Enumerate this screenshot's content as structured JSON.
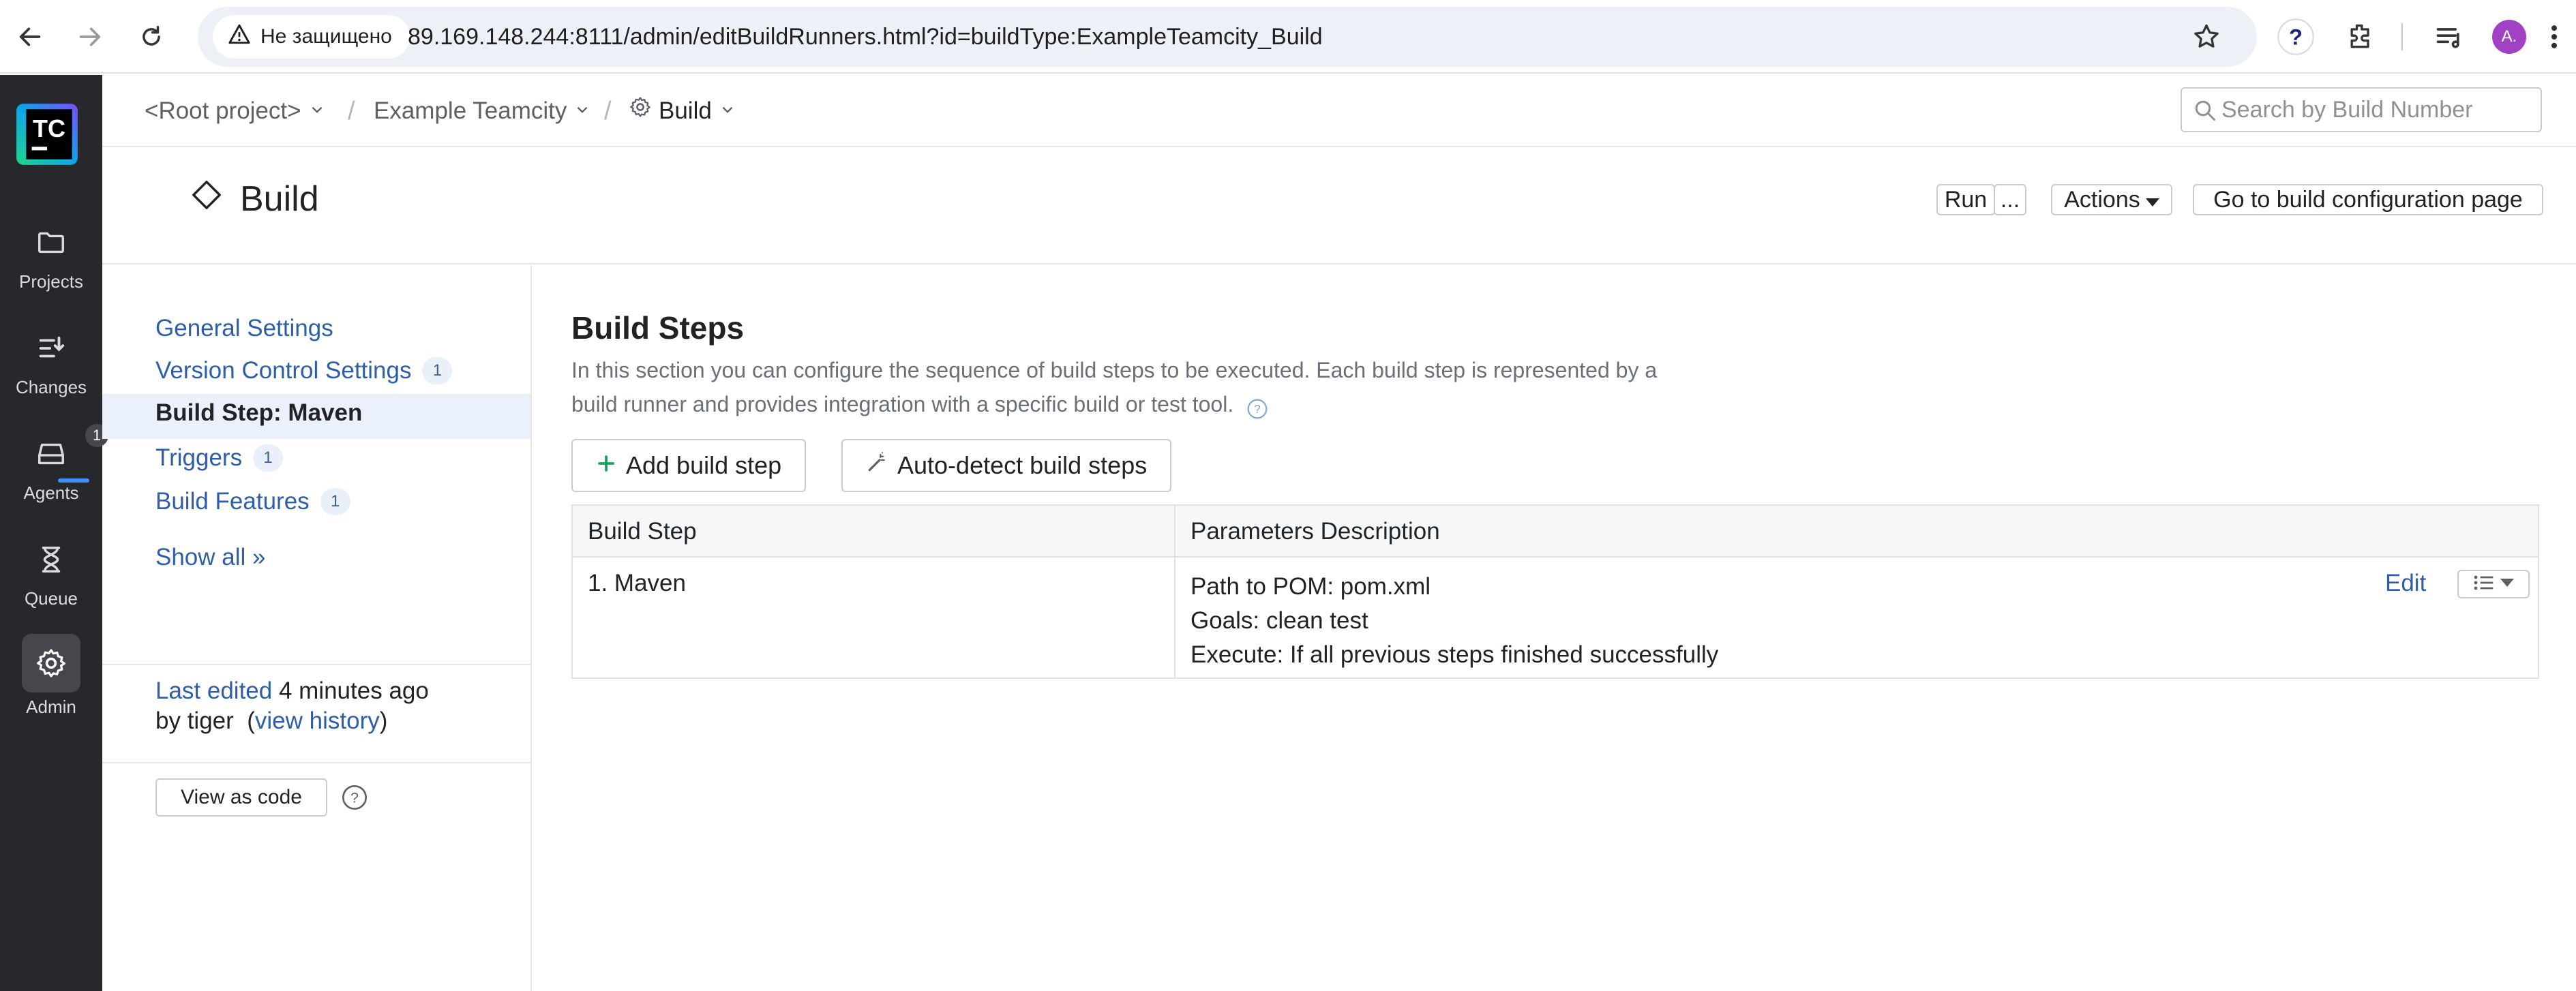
{
  "browser": {
    "security_label": "Не защищено",
    "url": "89.169.148.244:8111/admin/editBuildRunners.html?id=buildType:ExampleTeamcity_Build",
    "profile_initial": "A."
  },
  "rail": {
    "logo_text": "TC",
    "items": [
      {
        "label": "Projects",
        "icon": "folder-icon"
      },
      {
        "label": "Changes",
        "icon": "changes-icon"
      },
      {
        "label": "Agents",
        "icon": "agents-icon",
        "badge": "1"
      },
      {
        "label": "Queue",
        "icon": "hourglass-icon"
      },
      {
        "label": "Admin",
        "icon": "gear-icon"
      }
    ]
  },
  "header": {
    "breadcrumbs": [
      "<Root project>",
      "Example Teamcity",
      "Build"
    ],
    "search_placeholder": "Search by Build Number"
  },
  "title": {
    "text": "Build",
    "run_label": "Run",
    "more_label": "...",
    "actions_label": "Actions",
    "goto_label": "Go to build configuration page"
  },
  "sidebar": {
    "general": "General Settings",
    "vcs": "Version Control Settings",
    "vcs_count": "1",
    "active": "Build Step: Maven",
    "triggers": "Triggers",
    "triggers_count": "1",
    "features": "Build Features",
    "features_count": "1",
    "show_all": "Show all »",
    "last_edited_link": "Last edited",
    "last_edited_time": " 4 minutes ago",
    "by_user": "by tiger  (",
    "view_history": "view history",
    "close_paren": ")",
    "view_as_code": "View as code"
  },
  "main": {
    "heading": "Build Steps",
    "description": "In this section you can configure the sequence of build steps to be executed. Each build step is represented by a build runner and provides integration with a specific build or test tool.",
    "add_step": "Add build step",
    "auto_detect": "Auto-detect build steps",
    "table": {
      "col1": "Build Step",
      "col2": "Parameters Description",
      "rows": [
        {
          "step": "1. Maven",
          "params": [
            "Path to POM: pom.xml",
            "Goals: clean test",
            "Execute: If all previous steps finished successfully"
          ],
          "edit": "Edit"
        }
      ]
    }
  },
  "colors": {
    "link": "#2e5ea7",
    "rail": "#27282c",
    "accent_green": "#1aa364"
  }
}
